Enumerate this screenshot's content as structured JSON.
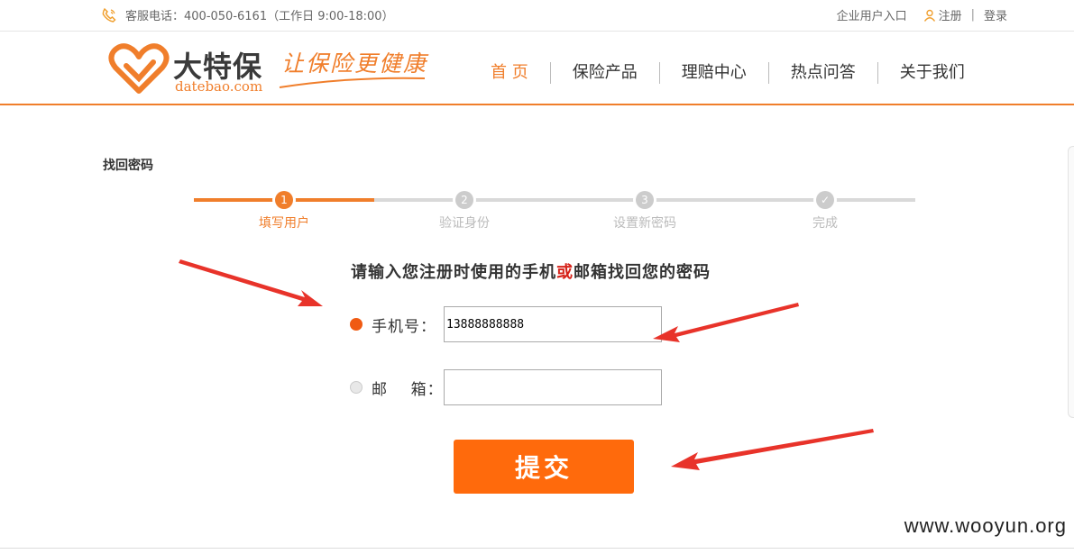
{
  "topbar": {
    "phone_text": "客服电话：400-050-6161（工作日 9:00-18:00）",
    "enterprise_entry": "企业用户入口",
    "register": "注册",
    "separator": "|",
    "login": "登录"
  },
  "brand": {
    "name": "大特保",
    "domain": "datebao.com",
    "slogan": "让保险更健康",
    "color": "#f07e2b"
  },
  "nav": [
    "首 页",
    "保险产品",
    "理赔中心",
    "热点问答",
    "关于我们"
  ],
  "page": {
    "title": "找回密码",
    "steps": [
      {
        "num": "1",
        "label": "填写用户",
        "active": true
      },
      {
        "num": "2",
        "label": "验证身份",
        "active": false
      },
      {
        "num": "3",
        "label": "设置新密码",
        "active": false
      },
      {
        "num": "✓",
        "label": "完成",
        "active": false
      }
    ],
    "prompt_before": "请输入您注册时使用的手机",
    "prompt_highlight": "或",
    "prompt_after": "邮箱找回您的密码",
    "phone_label": "手机号：",
    "phone_value": "13888888888",
    "email_label": "邮    箱：",
    "email_value": "",
    "submit_label": "提交"
  },
  "watermark": "www.wooyun.org"
}
